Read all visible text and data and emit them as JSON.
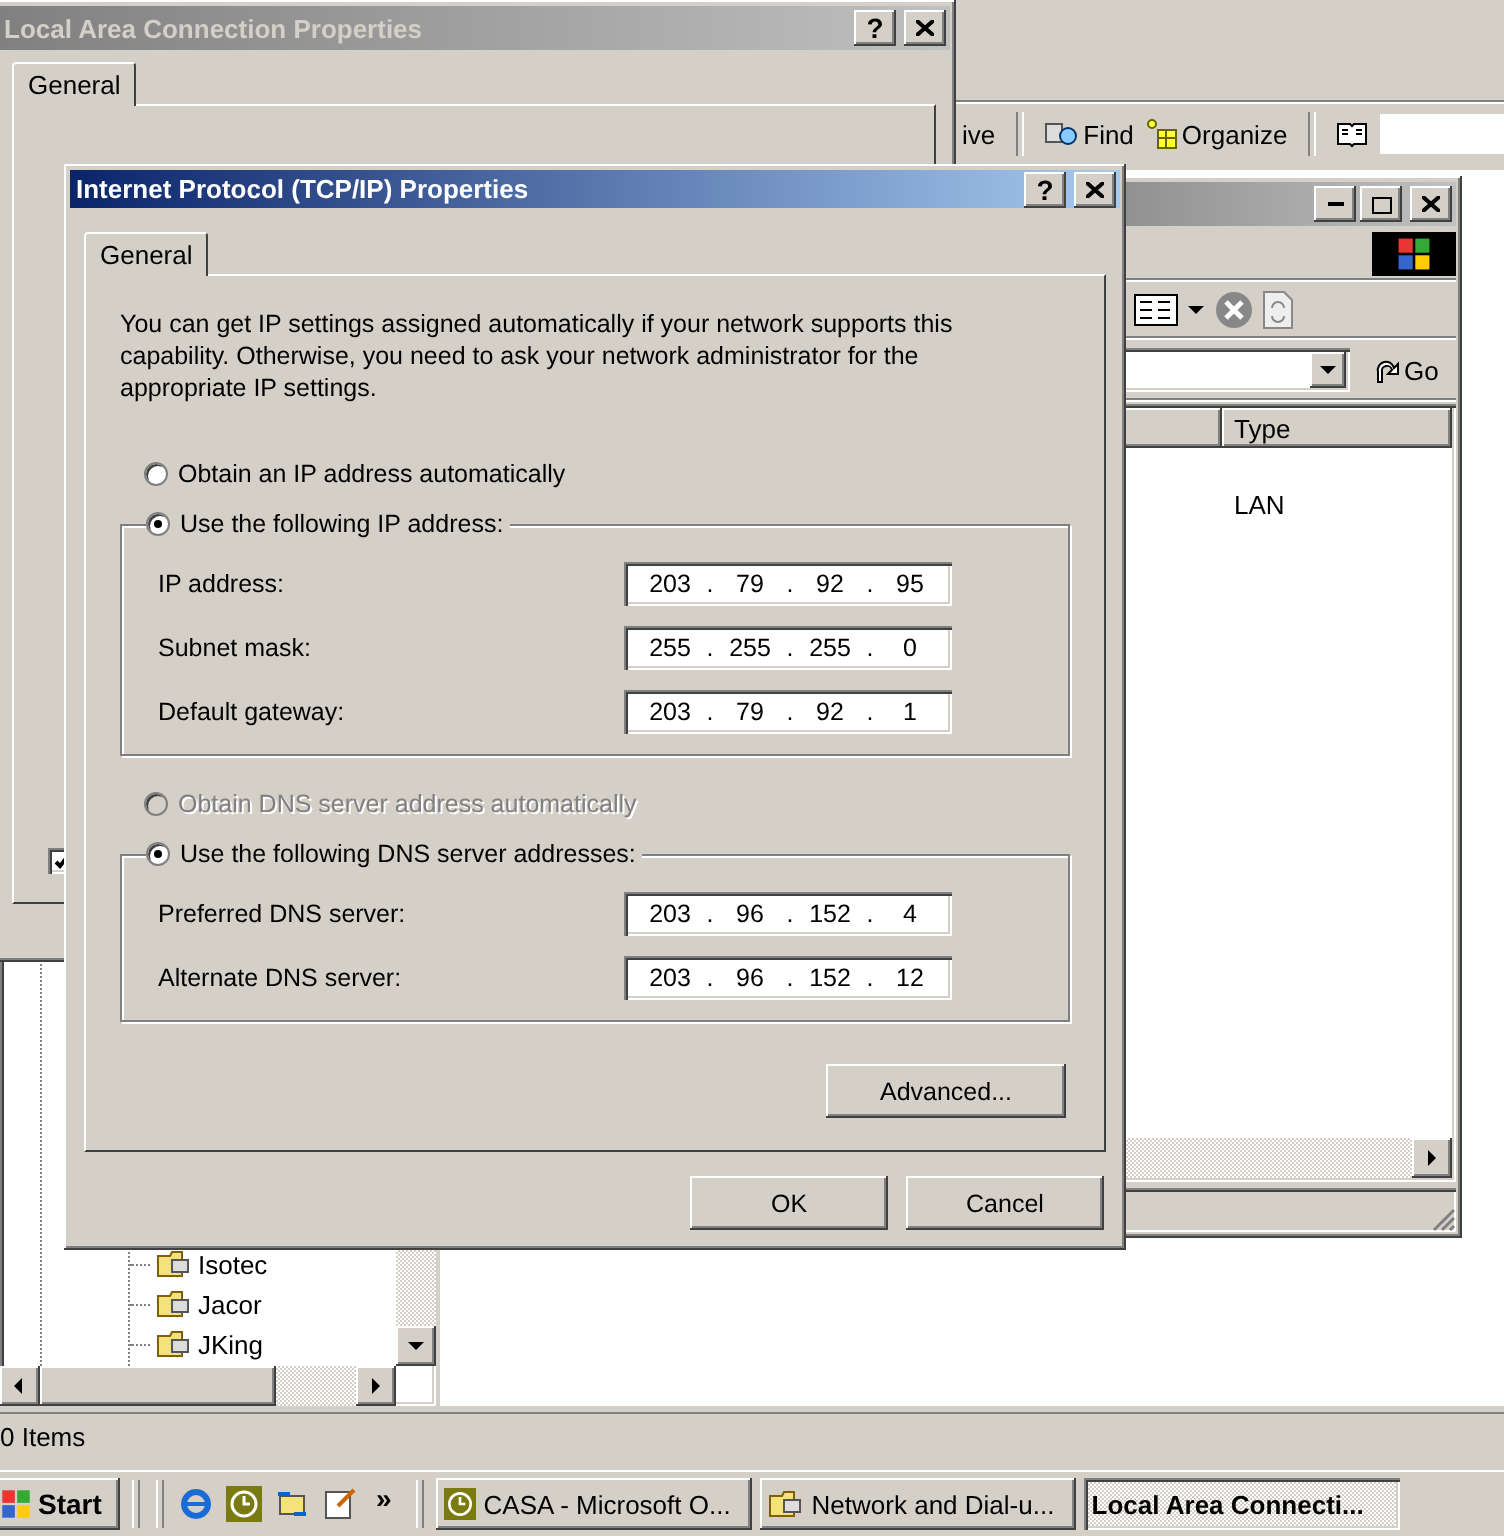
{
  "background_window": {
    "toolbar": [
      {
        "label": "ive",
        "kind": "text"
      },
      {
        "label": "Find",
        "kind": "find"
      },
      {
        "label": "Organize",
        "kind": "organize"
      }
    ],
    "tree": {
      "items": [
        {
          "label": "Isotec"
        },
        {
          "label": "Jacor"
        },
        {
          "label": "JKing"
        }
      ]
    },
    "status_bar": "0 Items"
  },
  "explorer_window": {
    "go_button": "Go",
    "columns": [
      {
        "label": "Type"
      }
    ],
    "rows": [
      {
        "type": "LAN"
      }
    ]
  },
  "lan_dialog": {
    "title": "Local Area Connection Properties",
    "help_button": "?",
    "tabs": [
      {
        "label": "General",
        "selected": true
      }
    ],
    "checkbox": {
      "checked": true
    }
  },
  "tcp_dialog": {
    "title": "Internet Protocol (TCP/IP) Properties",
    "help_button": "?",
    "tabs": [
      {
        "label": "General",
        "selected": true
      }
    ],
    "description": "You can get IP settings assigned automatically if your network supports this capability. Otherwise, you need to ask your network administrator for the appropriate IP settings.",
    "octet_separator": ".",
    "ip_options": [
      {
        "label": "Obtain an IP address automatically",
        "selected": false,
        "disabled": false
      },
      {
        "label": "Use the following IP address:",
        "selected": true,
        "disabled": false
      }
    ],
    "ip_fields": [
      {
        "label": "IP address:",
        "octets": [
          "203",
          "79",
          "92",
          "95"
        ]
      },
      {
        "label": "Subnet mask:",
        "octets": [
          "255",
          "255",
          "255",
          "0"
        ]
      },
      {
        "label": "Default gateway:",
        "octets": [
          "203",
          "79",
          "92",
          "1"
        ]
      }
    ],
    "dns_options": [
      {
        "label": "Obtain DNS server address automatically",
        "selected": false,
        "disabled": true
      },
      {
        "label": "Use the following DNS server addresses:",
        "selected": true,
        "disabled": false
      }
    ],
    "dns_fields": [
      {
        "label": "Preferred DNS server:",
        "octets": [
          "203",
          "96",
          "152",
          "4"
        ]
      },
      {
        "label": "Alternate DNS server:",
        "octets": [
          "203",
          "96",
          "152",
          "12"
        ]
      }
    ],
    "advanced_button": "Advanced...",
    "buttons": [
      "OK",
      "Cancel"
    ]
  },
  "taskbar": {
    "start": "Start",
    "more": "»",
    "tasks": [
      {
        "label": "CASA - Microsoft O...",
        "selected": false
      },
      {
        "label": "Network and Dial-u...",
        "selected": false
      },
      {
        "label": "Local Area Connecti...",
        "selected": true
      }
    ]
  }
}
